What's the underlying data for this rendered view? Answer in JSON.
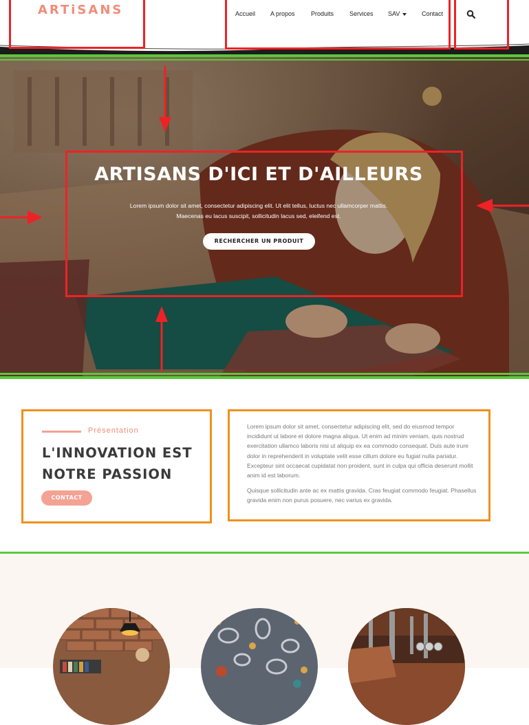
{
  "header": {
    "logo": "ARTiSANS",
    "nav": [
      {
        "label": "Accueil"
      },
      {
        "label": "A propos"
      },
      {
        "label": "Produits"
      },
      {
        "label": "Services"
      },
      {
        "label": "SAV"
      },
      {
        "label": "Contact"
      }
    ]
  },
  "hero": {
    "title": "ARTISANS D'ICI ET D'AILLEURS",
    "text_line1": "Lorem ipsum dolor sit amet, consectetur adipiscing elit. Ut elit tellus, luctus nec ullamcorper mattis.",
    "text_line2": "Maecenas eu lacus suscipit, sollicitudin lacus sed, eleifend est.",
    "button": "RECHERCHER UN PRODUIT"
  },
  "presentation": {
    "label": "Présentation",
    "title_line1": "L'INNOVATION EST",
    "title_line2": "NOTRE PASSION",
    "button": "CONTACT",
    "para1": "Lorem ipsum dolor sit amet, consectetur adipiscing elit, sed do eiusmod tempor incididunt ut labore et dolore magna aliqua. Ut enim ad minim veniam, quis nostrud exercitation ullamco laboris nisi ut aliquip ex ea commodo consequat. Duis aute irure dolor in reprehenderit in voluptate velit esse cillum dolore eu fugiat nulla pariatur. Excepteur sint occaecat cupidatat non proident, sunt in culpa qui officia deserunt mollit anim id est laborum.",
    "para2": "Quisque sollicitudin ante ac ex mattis gravida. Cras feugiat commodo feugiat. Phasellus gravida enim non purus posuere, nec varius ex gravida."
  },
  "colors": {
    "accent": "#f08c78",
    "annotation_red": "#ee2226",
    "annotation_orange": "#f0901c",
    "annotation_green": "#5ac83c"
  }
}
